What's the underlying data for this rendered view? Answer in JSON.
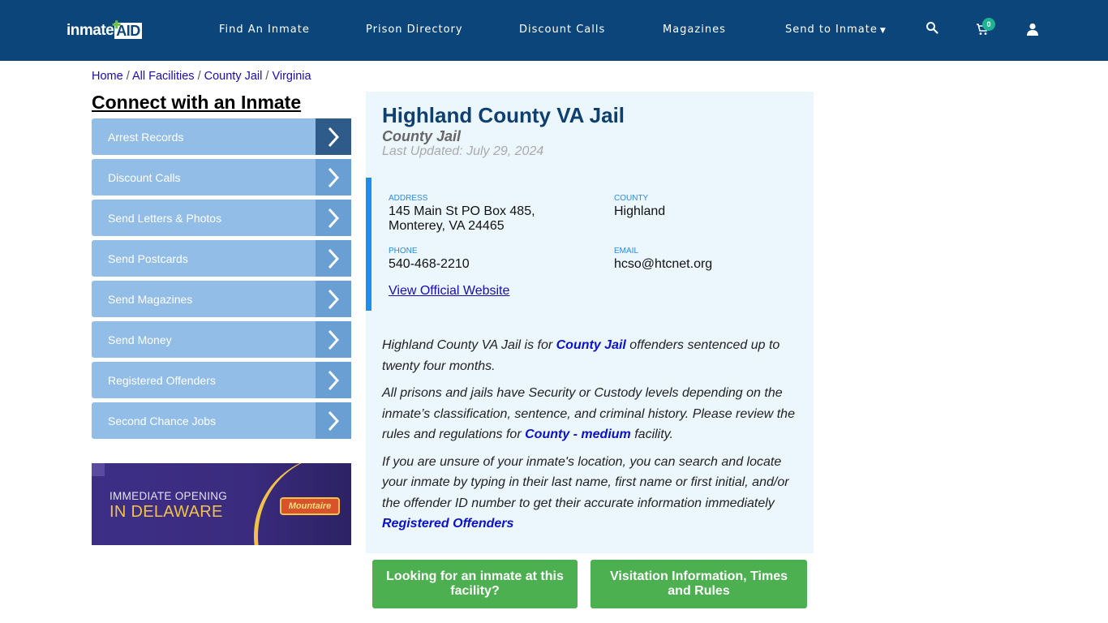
{
  "header": {
    "logo_main": "inmate",
    "logo_accent": "AID",
    "nav": [
      "Find An Inmate",
      "Prison Directory",
      "Discount Calls",
      "Magazines",
      "Send to Inmate"
    ],
    "cart_count": "0"
  },
  "breadcrumb": [
    "Home",
    "All Facilities",
    "County Jail",
    "Virginia"
  ],
  "sidebar": {
    "title": "Connect with an Inmate",
    "items": [
      {
        "label": "Arrest Records"
      },
      {
        "label": "Discount Calls"
      },
      {
        "label": "Send Letters & Photos"
      },
      {
        "label": "Send Postcards"
      },
      {
        "label": "Send Magazines"
      },
      {
        "label": "Send Money"
      },
      {
        "label": "Registered Offenders"
      },
      {
        "label": "Second Chance Jobs"
      }
    ],
    "ad": {
      "line1": "IMMEDIATE OPENING",
      "line2": "IN DELAWARE",
      "brand": "Mountaire"
    }
  },
  "facility": {
    "name": "Highland County VA Jail",
    "type": "County Jail",
    "last_updated": "Last Updated: July 29, 2024",
    "address_label": "ADDRESS",
    "address_line1": "145 Main St PO Box 485,",
    "address_line2": "Monterey, VA 24465",
    "county_label": "COUNTY",
    "county": "Highland",
    "phone_label": "PHONE",
    "phone": "540-468-2210",
    "email_label": "EMAIL",
    "email": "hcso@htcnet.org",
    "website_link": "View Official Website"
  },
  "description": {
    "p1_a": "Highland County VA Jail is for ",
    "p1_link": "County Jail",
    "p1_b": " offenders sentenced up to twenty four months.",
    "p2_a": "All prisons and jails have Security or Custody levels depending on the inmate’s classification, sentence, and criminal history. Please review the rules and regulations for ",
    "p2_link": "County - medium",
    "p2_b": " facility.",
    "p3": "If you are unsure of your inmate's location, you can search and locate your inmate by typing in their last name, first name or first initial, and/or the offender ID number to get their accurate information immediately ",
    "p3_link": "Registered Offenders"
  },
  "buttons": {
    "find_inmate": "Looking for an inmate at this facility?",
    "visitation": "Visitation Information, Times and Rules"
  }
}
